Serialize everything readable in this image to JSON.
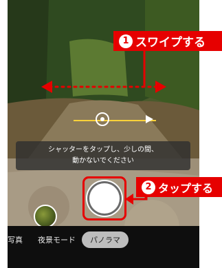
{
  "toast": {
    "line1": "シャッターをタップし、少しの間、",
    "line2": "動かないでください"
  },
  "modes": [
    {
      "label": "写真"
    },
    {
      "label": "夜景モード"
    },
    {
      "label": "パノラマ"
    }
  ],
  "callouts": [
    {
      "number": "1",
      "text": "スワイプする"
    },
    {
      "number": "2",
      "text": "タップする"
    }
  ],
  "colors": {
    "accent": "#e60000",
    "guide": "#ffd23a",
    "toast_bg": "#303030"
  },
  "icons": [
    "swipe-arrows-icon",
    "direction-arrow-icon",
    "shutter-button"
  ]
}
